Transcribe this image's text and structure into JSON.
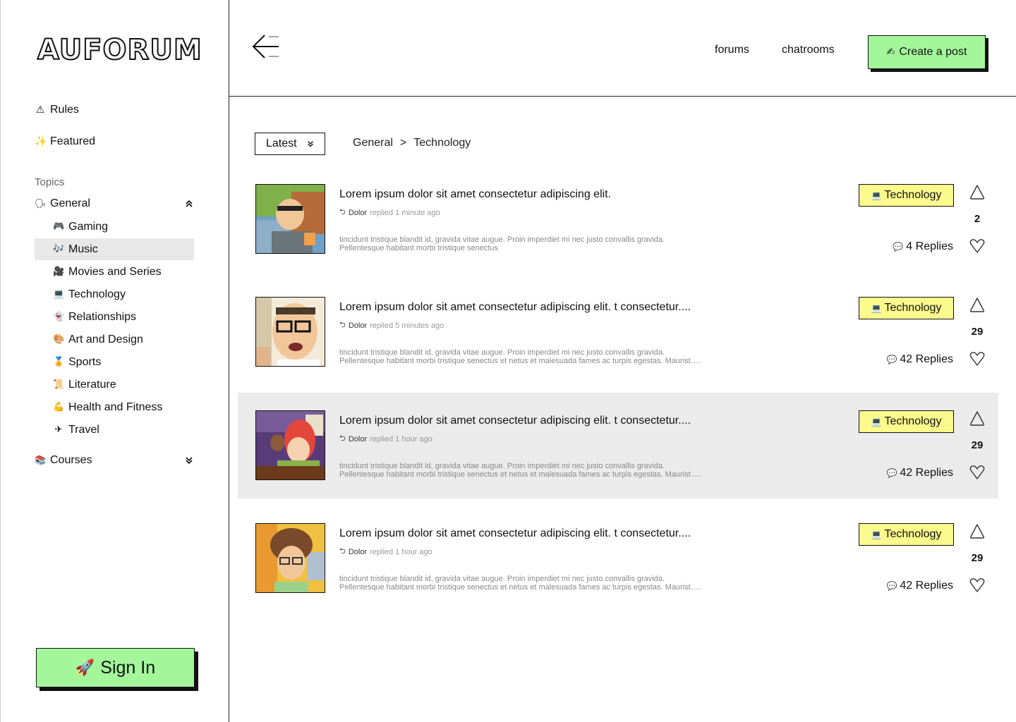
{
  "logo": "AUFORUM",
  "sidebar": {
    "links": [
      {
        "icon": "⚠",
        "icon_name": "warning-icon",
        "label": "Rules"
      },
      {
        "icon": "✨",
        "icon_name": "sparkle-icon",
        "label": "Featured"
      }
    ],
    "topics_label": "Topics",
    "general": {
      "icon": "🗣",
      "icon_name": "speaking-head-icon",
      "label": "General",
      "expanded": true
    },
    "items": [
      {
        "icon": "🎮",
        "icon_name": "gamepad-icon",
        "label": "Gaming"
      },
      {
        "icon": "🎶",
        "icon_name": "music-notes-icon",
        "label": "Music"
      },
      {
        "icon": "🎥",
        "icon_name": "movie-camera-icon",
        "label": "Movies and Series"
      },
      {
        "icon": "💻",
        "icon_name": "laptop-icon",
        "label": "Technology"
      },
      {
        "icon": "👻",
        "icon_name": "ghost-icon",
        "label": "Relationships"
      },
      {
        "icon": "🎨",
        "icon_name": "palette-icon",
        "label": "Art and Design"
      },
      {
        "icon": "🏅",
        "icon_name": "medal-icon",
        "label": "Sports"
      },
      {
        "icon": "📜",
        "icon_name": "scroll-icon",
        "label": "Literature"
      },
      {
        "icon": "💪",
        "icon_name": "flexed-biceps-icon",
        "label": "Health and Fitness"
      },
      {
        "icon": "✈",
        "icon_name": "airplane-icon",
        "label": "Travel"
      }
    ],
    "active_item": "Music",
    "courses": {
      "icon": "📚",
      "icon_name": "books-icon",
      "label": "Courses",
      "expanded": false
    },
    "signin": {
      "icon": "🚀",
      "icon_name": "rocket-icon",
      "label": "Sign In"
    }
  },
  "header": {
    "nav": [
      "forums",
      "chatrooms"
    ],
    "create": {
      "icon": "✍",
      "icon_name": "writing-hand-icon",
      "label": "Create a post"
    }
  },
  "filter": {
    "sort": "Latest",
    "breadcrumb": [
      "General",
      ">",
      "Technology"
    ]
  },
  "posts": [
    {
      "title": "Lorem ipsum dolor sit amet consectetur adipiscing elit.",
      "user": "Dolor",
      "replied": "replied 1 minute ago",
      "excerpt1": "tincidunt tristique blandit id, gravida vitae augue. Proin imperdiet mi nec justo convallis gravida.",
      "excerpt2": "Pellentesque habitant morbi tristique senectus",
      "tag": "Technology",
      "tag_icon": "💻",
      "replies": "4 Replies",
      "votes": "2",
      "highlighted": false
    },
    {
      "title": "Lorem ipsum dolor sit amet consectetur adipiscing elit. t consectetur....",
      "user": "Dolor",
      "replied": "replied 5 minutes ago",
      "excerpt1": "tincidunt tristique blandit id, gravida vitae augue. Proin imperdiet mi nec justo convallis gravida.",
      "excerpt2": "Pellentesque habitant morbi tristique senectus et netus et malesuada fames ac turpis egestas. Maurist.....",
      "tag": "Technology",
      "tag_icon": "💻",
      "replies": "42 Replies",
      "votes": "29",
      "highlighted": false
    },
    {
      "title": "Lorem ipsum dolor sit amet consectetur adipiscing elit. t consectetur....",
      "user": "Dolor",
      "replied": "replied 1 hour ago",
      "excerpt1": "tincidunt tristique blandit id, gravida vitae augue. Proin imperdiet mi nec justo convallis gravida.",
      "excerpt2": "Pellentesque habitant morbi tristique senectus et netus et malesuada fames ac turpis egestas. Maurist.....",
      "tag": "Technology",
      "tag_icon": "💻",
      "replies": "42 Replies",
      "votes": "29",
      "highlighted": true
    },
    {
      "title": "Lorem ipsum dolor sit amet consectetur adipiscing elit. t consectetur....",
      "user": "Dolor",
      "replied": "replied 1 hour ago",
      "excerpt1": "tincidunt tristique blandit id, gravida vitae augue. Proin imperdiet mi nec justo convallis gravida.",
      "excerpt2": "Pellentesque habitant morbi tristique senectus et netus et malesuada fames ac turpis egestas. Maurist.....",
      "tag": "Technology",
      "tag_icon": "💻",
      "replies": "42 Replies",
      "votes": "29",
      "highlighted": false
    }
  ],
  "colors": {
    "accent_green": "#a3f79a",
    "tag_yellow": "#fbfa8c",
    "highlight_row": "#ebebeb"
  }
}
